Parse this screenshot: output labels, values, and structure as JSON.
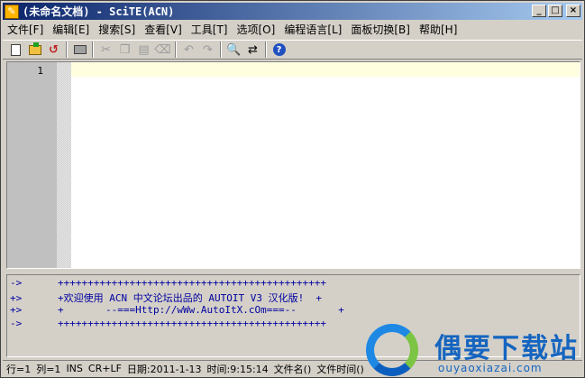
{
  "window": {
    "title": "(未命名文档) - SciTE(ACN)"
  },
  "window_buttons": {
    "minimize": "_",
    "maximize": "□",
    "close": "×"
  },
  "menu": [
    "文件[F]",
    "编辑[E]",
    "搜索[S]",
    "查看[V]",
    "工具[T]",
    "选项[O]",
    "编程语言[L]",
    "面板切换[B]",
    "帮助[H]"
  ],
  "toolbar_icons": [
    "new-file-icon",
    "open-file-icon",
    "revert-icon",
    "print-icon",
    "cut-icon",
    "copy-icon",
    "paste-icon",
    "delete-icon",
    "undo-icon",
    "redo-icon",
    "find-icon",
    "replace-icon",
    "help-icon"
  ],
  "editor": {
    "line_numbers": [
      "1"
    ],
    "caret_line_color": "#ffffe0"
  },
  "output": {
    "lines": [
      "->      +++++++++++++++++++++++++++++++++++++++++++++",
      "+>      +欢迎使用 ACN 中文论坛出品的 AUTOIT V3 汉化版!  +",
      "+>      +       --===Http://wWw.AutoItX.cOm===--       +",
      "->      +++++++++++++++++++++++++++++++++++++++++++++"
    ],
    "text_color": "#0000a0"
  },
  "status": {
    "line": "行=1",
    "col": "列=1",
    "mode": "INS",
    "eol": "CR+LF",
    "date": "日期:2011-1-13",
    "time": "时间:9:15:14",
    "filename": "文件名()",
    "filetime": "文件时间()"
  },
  "watermark": {
    "title": "偶要下载站",
    "subtitle": "ouyaoxiazai.com"
  },
  "colors": {
    "titlebar": "#0a246a",
    "chrome": "#d4d0c8",
    "watermark": "#1565c0"
  }
}
